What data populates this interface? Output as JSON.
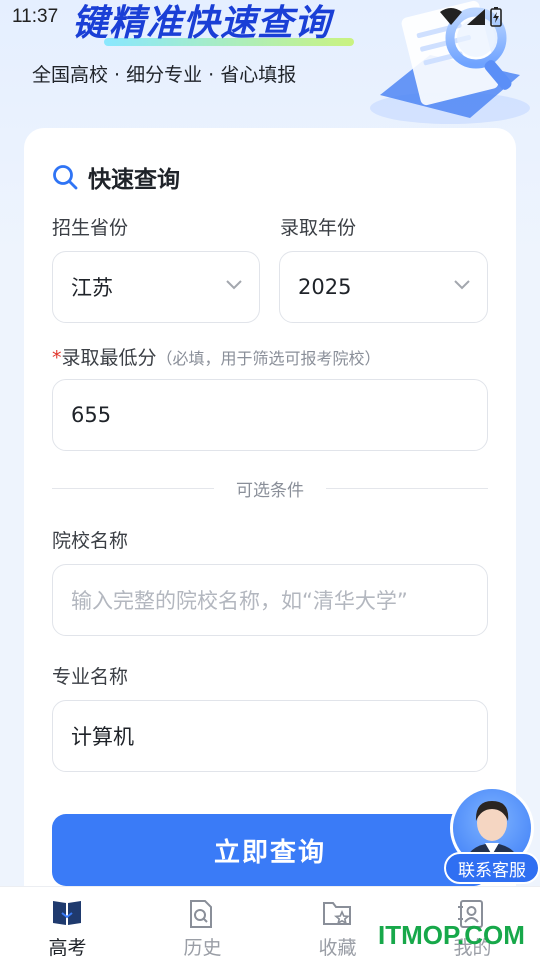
{
  "status_bar": {
    "time": "11:37"
  },
  "banner": {
    "title": "键精准快速查询",
    "subtitle": "全国高校 · 细分专业 · 省心填报"
  },
  "card": {
    "title": "快速查询",
    "province": {
      "label": "招生省份",
      "value": "江苏"
    },
    "year": {
      "label": "录取年份",
      "value": "2025"
    },
    "min_score": {
      "required_mark": "*",
      "label": "录取最低分",
      "hint": "（必填，用于筛选可报考院校）",
      "value": "655"
    },
    "optional_divider": "可选条件",
    "school": {
      "label": "院校名称",
      "placeholder": "输入完整的院校名称，如“清华大学”"
    },
    "major": {
      "label": "专业名称",
      "value": "计算机"
    },
    "submit_label": "立即查询"
  },
  "customer_service": {
    "label": "联系客服"
  },
  "bottom_nav": {
    "items": [
      {
        "label": "高考",
        "icon": "book-icon",
        "active": true
      },
      {
        "label": "历史",
        "icon": "history-doc-icon",
        "active": false
      },
      {
        "label": "收藏",
        "icon": "folder-star-icon",
        "active": false
      },
      {
        "label": "我的",
        "icon": "contact-book-icon",
        "active": false
      }
    ]
  },
  "watermark": "ITMOP.COM",
  "colors": {
    "accent": "#3a7bf7",
    "required": "#e0352b",
    "watermark": "#17a84a"
  }
}
